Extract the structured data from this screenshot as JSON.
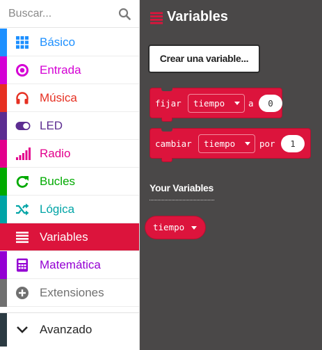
{
  "search": {
    "placeholder": "Buscar..."
  },
  "categories": [
    {
      "label": "Básico",
      "color": "#1e90ff",
      "icon": "grid-icon"
    },
    {
      "label": "Entrada",
      "color": "#d400d4",
      "icon": "target-icon"
    },
    {
      "label": "Música",
      "color": "#e63022",
      "icon": "headphones-icon"
    },
    {
      "label": "LED",
      "color": "#5c2d91",
      "icon": "toggle-icon"
    },
    {
      "label": "Radio",
      "color": "#e3008c",
      "icon": "signal-bars-icon"
    },
    {
      "label": "Bucles",
      "color": "#00aa00",
      "icon": "refresh-icon"
    },
    {
      "label": "Lógica",
      "color": "#00a4a6",
      "icon": "shuffle-icon"
    },
    {
      "label": "Variables",
      "color": "#dc143c",
      "icon": "list-lines-icon",
      "selected": true
    },
    {
      "label": "Matemática",
      "color": "#9400d3",
      "icon": "calculator-icon"
    },
    {
      "label": "Extensiones",
      "color": "#707070",
      "icon": "plus-circle-icon"
    }
  ],
  "advanced": {
    "label": "Avanzado",
    "icon": "chevron-down-icon",
    "color": "#2b3a42"
  },
  "flyout": {
    "title": "Variables",
    "create_button": "Crear una variable...",
    "set_block": {
      "verb": "fijar",
      "variable": "tiempo",
      "connector": "a",
      "value": "0"
    },
    "change_block": {
      "verb": "cambiar",
      "variable": "tiempo",
      "connector": "por",
      "value": "1"
    },
    "section_title": "Your Variables",
    "variables": [
      "tiempo"
    ]
  },
  "colors": {
    "variables": "#dc143c",
    "flyout_bg": "#4a4848"
  }
}
